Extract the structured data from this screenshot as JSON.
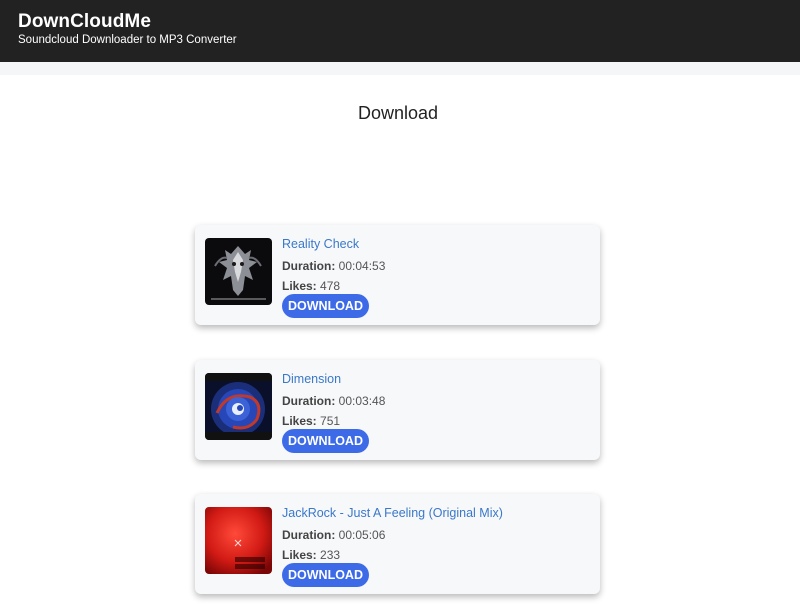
{
  "header": {
    "brand_title": "DownCloudMe",
    "brand_subtitle": "Soundcloud Downloader to MP3 Converter"
  },
  "page": {
    "heading": "Download"
  },
  "colors": {
    "header_bg": "#222222",
    "link": "#3a78c9",
    "button": "#3d6be8",
    "card_bg": "#f7f8fa"
  },
  "labels": {
    "duration": "Duration:",
    "likes": "Likes:",
    "download_button": "DOWNLOAD"
  },
  "tracks": [
    {
      "title": "Reality Check",
      "duration": "00:04:53",
      "likes": "478",
      "artwork_icon": "dark-metallic-skull-artwork"
    },
    {
      "title": "Dimension",
      "duration": "00:03:48",
      "likes": "751",
      "artwork_icon": "blue-vortex-artwork"
    },
    {
      "title": "JackRock - Just A Feeling (Original Mix)",
      "duration": "00:05:06",
      "likes": "233",
      "artwork_icon": "red-jackrock-artwork"
    }
  ]
}
